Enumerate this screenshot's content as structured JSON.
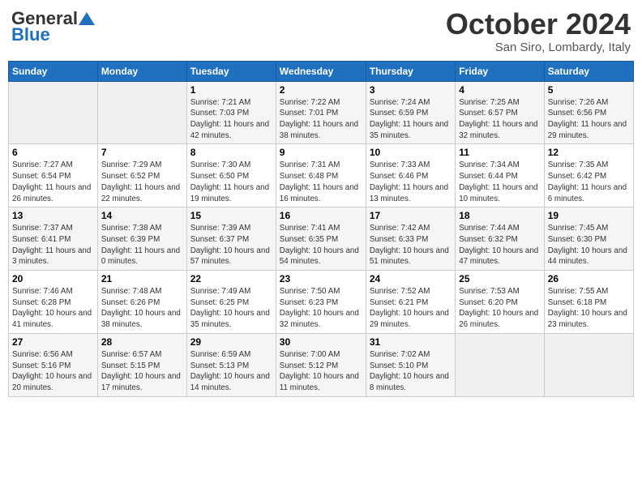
{
  "header": {
    "logo_general": "General",
    "logo_blue": "Blue",
    "month": "October 2024",
    "location": "San Siro, Lombardy, Italy"
  },
  "days_of_week": [
    "Sunday",
    "Monday",
    "Tuesday",
    "Wednesday",
    "Thursday",
    "Friday",
    "Saturday"
  ],
  "weeks": [
    [
      {
        "day": "",
        "info": ""
      },
      {
        "day": "",
        "info": ""
      },
      {
        "day": "1",
        "info": "Sunrise: 7:21 AM\nSunset: 7:03 PM\nDaylight: 11 hours and 42 minutes."
      },
      {
        "day": "2",
        "info": "Sunrise: 7:22 AM\nSunset: 7:01 PM\nDaylight: 11 hours and 38 minutes."
      },
      {
        "day": "3",
        "info": "Sunrise: 7:24 AM\nSunset: 6:59 PM\nDaylight: 11 hours and 35 minutes."
      },
      {
        "day": "4",
        "info": "Sunrise: 7:25 AM\nSunset: 6:57 PM\nDaylight: 11 hours and 32 minutes."
      },
      {
        "day": "5",
        "info": "Sunrise: 7:26 AM\nSunset: 6:56 PM\nDaylight: 11 hours and 29 minutes."
      }
    ],
    [
      {
        "day": "6",
        "info": "Sunrise: 7:27 AM\nSunset: 6:54 PM\nDaylight: 11 hours and 26 minutes."
      },
      {
        "day": "7",
        "info": "Sunrise: 7:29 AM\nSunset: 6:52 PM\nDaylight: 11 hours and 22 minutes."
      },
      {
        "day": "8",
        "info": "Sunrise: 7:30 AM\nSunset: 6:50 PM\nDaylight: 11 hours and 19 minutes."
      },
      {
        "day": "9",
        "info": "Sunrise: 7:31 AM\nSunset: 6:48 PM\nDaylight: 11 hours and 16 minutes."
      },
      {
        "day": "10",
        "info": "Sunrise: 7:33 AM\nSunset: 6:46 PM\nDaylight: 11 hours and 13 minutes."
      },
      {
        "day": "11",
        "info": "Sunrise: 7:34 AM\nSunset: 6:44 PM\nDaylight: 11 hours and 10 minutes."
      },
      {
        "day": "12",
        "info": "Sunrise: 7:35 AM\nSunset: 6:42 PM\nDaylight: 11 hours and 6 minutes."
      }
    ],
    [
      {
        "day": "13",
        "info": "Sunrise: 7:37 AM\nSunset: 6:41 PM\nDaylight: 11 hours and 3 minutes."
      },
      {
        "day": "14",
        "info": "Sunrise: 7:38 AM\nSunset: 6:39 PM\nDaylight: 11 hours and 0 minutes."
      },
      {
        "day": "15",
        "info": "Sunrise: 7:39 AM\nSunset: 6:37 PM\nDaylight: 10 hours and 57 minutes."
      },
      {
        "day": "16",
        "info": "Sunrise: 7:41 AM\nSunset: 6:35 PM\nDaylight: 10 hours and 54 minutes."
      },
      {
        "day": "17",
        "info": "Sunrise: 7:42 AM\nSunset: 6:33 PM\nDaylight: 10 hours and 51 minutes."
      },
      {
        "day": "18",
        "info": "Sunrise: 7:44 AM\nSunset: 6:32 PM\nDaylight: 10 hours and 47 minutes."
      },
      {
        "day": "19",
        "info": "Sunrise: 7:45 AM\nSunset: 6:30 PM\nDaylight: 10 hours and 44 minutes."
      }
    ],
    [
      {
        "day": "20",
        "info": "Sunrise: 7:46 AM\nSunset: 6:28 PM\nDaylight: 10 hours and 41 minutes."
      },
      {
        "day": "21",
        "info": "Sunrise: 7:48 AM\nSunset: 6:26 PM\nDaylight: 10 hours and 38 minutes."
      },
      {
        "day": "22",
        "info": "Sunrise: 7:49 AM\nSunset: 6:25 PM\nDaylight: 10 hours and 35 minutes."
      },
      {
        "day": "23",
        "info": "Sunrise: 7:50 AM\nSunset: 6:23 PM\nDaylight: 10 hours and 32 minutes."
      },
      {
        "day": "24",
        "info": "Sunrise: 7:52 AM\nSunset: 6:21 PM\nDaylight: 10 hours and 29 minutes."
      },
      {
        "day": "25",
        "info": "Sunrise: 7:53 AM\nSunset: 6:20 PM\nDaylight: 10 hours and 26 minutes."
      },
      {
        "day": "26",
        "info": "Sunrise: 7:55 AM\nSunset: 6:18 PM\nDaylight: 10 hours and 23 minutes."
      }
    ],
    [
      {
        "day": "27",
        "info": "Sunrise: 6:56 AM\nSunset: 5:16 PM\nDaylight: 10 hours and 20 minutes."
      },
      {
        "day": "28",
        "info": "Sunrise: 6:57 AM\nSunset: 5:15 PM\nDaylight: 10 hours and 17 minutes."
      },
      {
        "day": "29",
        "info": "Sunrise: 6:59 AM\nSunset: 5:13 PM\nDaylight: 10 hours and 14 minutes."
      },
      {
        "day": "30",
        "info": "Sunrise: 7:00 AM\nSunset: 5:12 PM\nDaylight: 10 hours and 11 minutes."
      },
      {
        "day": "31",
        "info": "Sunrise: 7:02 AM\nSunset: 5:10 PM\nDaylight: 10 hours and 8 minutes."
      },
      {
        "day": "",
        "info": ""
      },
      {
        "day": "",
        "info": ""
      }
    ]
  ]
}
